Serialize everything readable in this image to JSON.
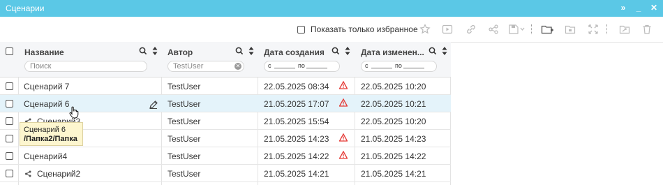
{
  "window": {
    "title": "Сценарии"
  },
  "toolbar": {
    "favorites_label": "Показать только избранное",
    "icons": [
      "star-icon",
      "play-icon",
      "link-icon",
      "share-icon",
      "save-icon",
      "new-folder-icon",
      "move-to-folder-icon",
      "expand-icon",
      "export-icon",
      "delete-icon"
    ]
  },
  "grid": {
    "columns": [
      {
        "label": "Название",
        "filter_placeholder": "Поиск"
      },
      {
        "label": "Автор",
        "filter_value": "TestUser"
      },
      {
        "label": "Дата создания",
        "from": "с",
        "to": "по"
      },
      {
        "label": "Дата изменен...",
        "from": "с",
        "to": "по"
      }
    ],
    "rows": [
      {
        "name": "Сценарий 7",
        "author": "TestUser",
        "created": "22.05.2025 08:34",
        "modified": "22.05.2025 10:20",
        "warning": true,
        "shared": false
      },
      {
        "name": "Сценарий 6",
        "author": "TestUser",
        "created": "21.05.2025 17:07",
        "modified": "22.05.2025 10:21",
        "warning": true,
        "shared": false,
        "highlighted": true
      },
      {
        "name": "Сценарий3",
        "author": "TestUser",
        "created": "21.05.2025 15:54",
        "modified": "22.05.2025 10:20",
        "warning": false,
        "shared": true
      },
      {
        "name": "",
        "author": "TestUser",
        "created": "21.05.2025 14:23",
        "modified": "21.05.2025 14:23",
        "warning": true,
        "shared": false
      },
      {
        "name": "Сценарий4",
        "author": "TestUser",
        "created": "21.05.2025 14:22",
        "modified": "21.05.2025 14:22",
        "warning": true,
        "shared": false
      },
      {
        "name": "Сценарий2",
        "author": "TestUser",
        "created": "21.05.2025 14:21",
        "modified": "21.05.2025 14:21",
        "warning": false,
        "shared": true
      }
    ]
  },
  "tooltip": {
    "line1": "Сценарий 6",
    "line2": "/Папка2/Папка"
  },
  "colors": {
    "titlebar": "#5bc8e6",
    "row_highlight": "#e4f3fa",
    "warning": "#e53935",
    "tooltip_bg": "#fdf6cf"
  }
}
